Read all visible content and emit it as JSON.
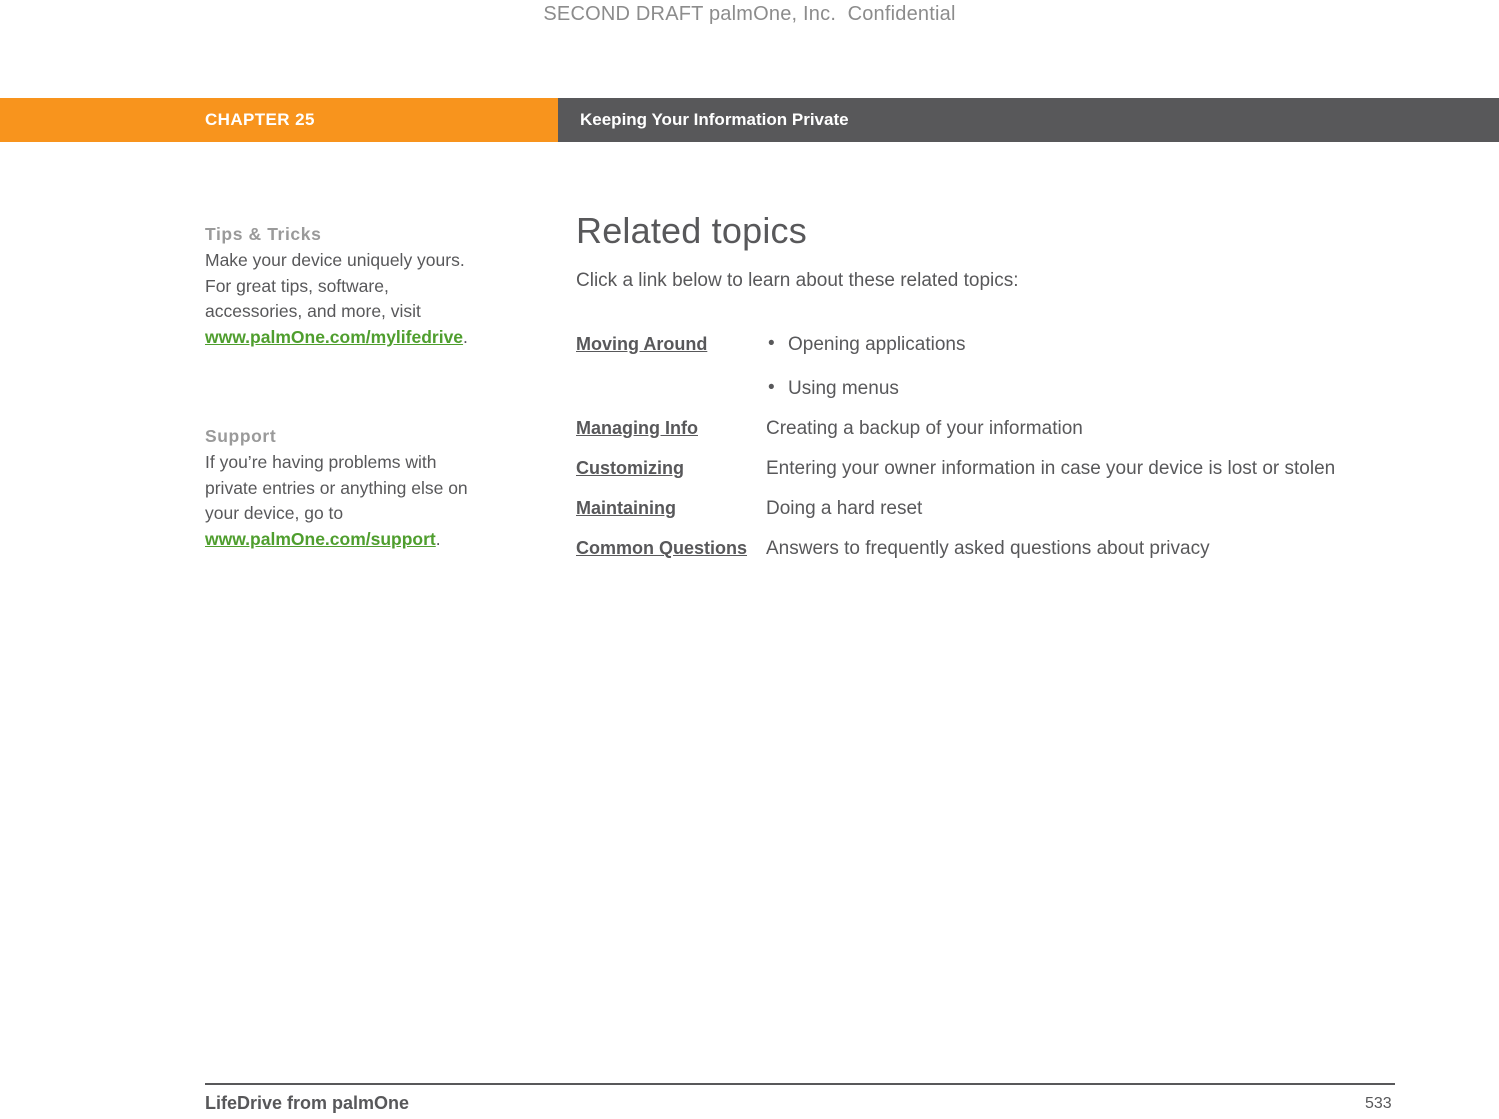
{
  "draft_notice": "SECOND DRAFT palmOne, Inc.  Confidential",
  "chapter_bar": {
    "chapter_label": "CHAPTER 25",
    "chapter_title": "Keeping Your Information Private"
  },
  "sidebar": {
    "blocks": [
      {
        "heading": "Tips & Tricks",
        "text_before": "Make your device uniquely yours. For great tips, software, accessories, and more, visit ",
        "link": "www.palmOne.com/mylifedrive",
        "text_after": "."
      },
      {
        "heading": "Support",
        "text_before": "If you’re having problems with private entries or anything else on your device, go to ",
        "link": "www.palmOne.com/support",
        "text_after": "."
      }
    ]
  },
  "main": {
    "title": "Related topics",
    "intro": "Click a link below to learn about these related topics:",
    "rows": [
      {
        "link": "Moving Around",
        "bullets": [
          "Opening applications",
          "Using menus"
        ],
        "description": ""
      },
      {
        "link": "Managing Info",
        "bullets": [],
        "description": "Creating a backup of your information"
      },
      {
        "link": "Customizing",
        "bullets": [],
        "description": "Entering your owner information in case your device is lost or stolen"
      },
      {
        "link": "Maintaining",
        "bullets": [],
        "description": "Doing a hard reset"
      },
      {
        "link": "Common Questions",
        "bullets": [],
        "description": "Answers to frequently asked questions about privacy"
      }
    ]
  },
  "footer": {
    "product": "LifeDrive from palmOne",
    "page_number": "533"
  }
}
